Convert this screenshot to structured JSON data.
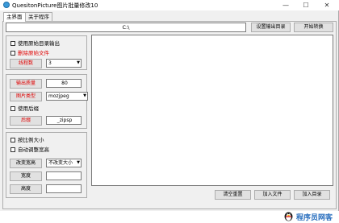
{
  "window": {
    "title": "QuesitonPicture图片批量修改10",
    "controls": {
      "minimize": "—",
      "maximize": "☐",
      "close": "✕"
    }
  },
  "tabs": [
    {
      "label": "主界面",
      "active": true
    },
    {
      "label": "关于程序",
      "active": false
    }
  ],
  "top": {
    "output_dir_value": "C:\\",
    "set_output_dir_label": "设置输出目录",
    "start_convert_label": "开始转换"
  },
  "left": {
    "use_original_dir_label": "使用原始目录输出",
    "delete_original_label": "删除原始文件",
    "thread_count_button": "线程数",
    "thread_count_value": "3",
    "output_quality_button": "输出质量",
    "output_quality_value": "80",
    "image_type_button": "图片类型",
    "image_type_value": "mozjpeg",
    "use_suffix_label": "使用后缀",
    "suffix_button": "后缀",
    "suffix_value": "_zipsp",
    "scale_size_label": "按比例大小",
    "auto_adjust_label": "自动调整宽高",
    "change_wh_button": "改变宽高",
    "change_wh_value": "不改变大小",
    "width_button": "宽度",
    "width_value": "",
    "height_button": "高度",
    "height_value": ""
  },
  "bottom": {
    "clear_reset_label": "清空重置",
    "add_file_label": "加入文件",
    "add_dir_label": "加入目录"
  },
  "watermark": {
    "text": "程序员网客"
  },
  "colors": {
    "warning_text": "#e00000",
    "watermark_text": "#2a6fbf"
  }
}
